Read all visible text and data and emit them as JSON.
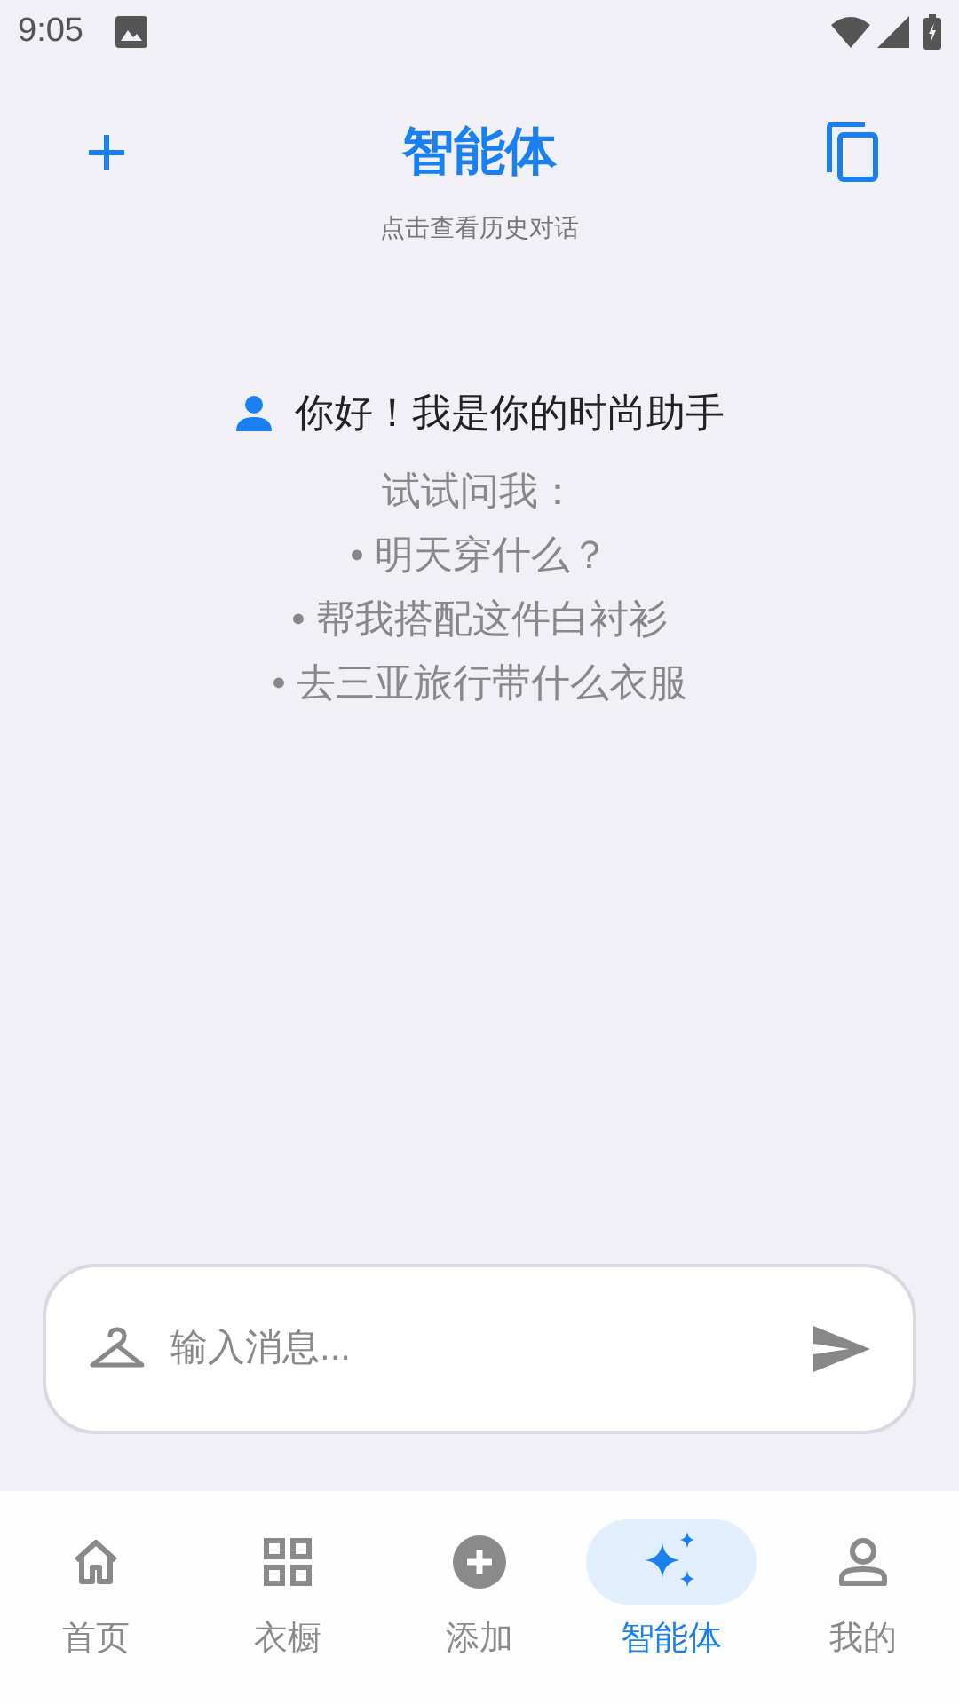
{
  "status_bar": {
    "time": "9:05"
  },
  "header": {
    "title": "智能体",
    "subtitle": "点击查看历史对话"
  },
  "welcome": {
    "greeting": "你好！我是你的时尚助手",
    "prompt": "试试问我：",
    "suggestions": [
      "• 明天穿什么？",
      "• 帮我搭配这件白衬衫",
      "• 去三亚旅行带什么衣服"
    ]
  },
  "composer": {
    "placeholder": "输入消息..."
  },
  "nav": [
    {
      "label": "首页",
      "selected": false
    },
    {
      "label": "衣橱",
      "selected": false
    },
    {
      "label": "添加",
      "selected": false
    },
    {
      "label": "智能体",
      "selected": true
    },
    {
      "label": "我的",
      "selected": false
    }
  ]
}
